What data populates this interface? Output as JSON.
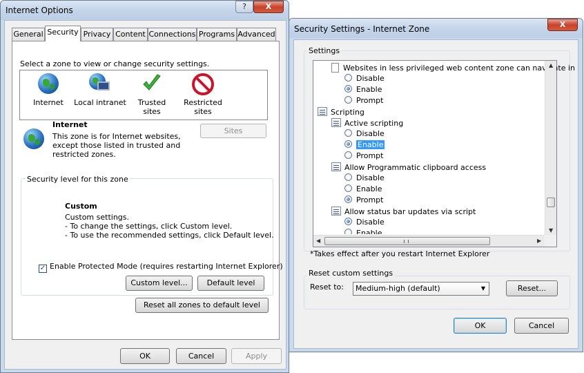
{
  "internet_options": {
    "title": "Internet Options",
    "help_button": "?",
    "close_button": "X",
    "tabs": [
      "General",
      "Security",
      "Privacy",
      "Content",
      "Connections",
      "Programs",
      "Advanced"
    ],
    "active_tab": "Security",
    "zone_prompt": "Select a zone to view or change security settings.",
    "zones": [
      "Internet",
      "Local intranet",
      "Trusted sites",
      "Restricted\nsites"
    ],
    "zone_title": "Internet",
    "zone_description": "This zone is for Internet websites,\nexcept those listed in trusted and\nrestricted zones.",
    "sites_button": "Sites",
    "security_level_label": "Security level for this zone",
    "level_name": "Custom",
    "level_desc": "Custom settings.\n- To change the settings, click Custom level.\n- To use the recommended settings, click Default level.",
    "protected_mode_label": "Enable Protected Mode (requires restarting Internet Explorer)",
    "protected_mode_checked": true,
    "custom_level_button": "Custom level...",
    "default_level_button": "Default level",
    "reset_all_button": "Reset all zones to default level",
    "ok_button": "OK",
    "cancel_button": "Cancel",
    "apply_button": "Apply"
  },
  "security_settings": {
    "title": "Security Settings - Internet Zone",
    "close_button": "X",
    "settings_label": "Settings",
    "tree": {
      "websites_less_privileged": "Websites in less privileged web content zone can navigate in",
      "opt_disable": "Disable",
      "opt_enable": "Enable",
      "opt_prompt": "Prompt",
      "scripting": "Scripting",
      "active_scripting": "Active scripting",
      "clipboard_access": "Allow Programmatic clipboard access",
      "status_bar": "Allow status bar updates via script"
    },
    "restart_note": "*Takes effect after you restart Internet Explorer",
    "reset_group_label": "Reset custom settings",
    "reset_to_label": "Reset to:",
    "reset_to_value": "Medium-high (default)",
    "reset_button": "Reset...",
    "ok_button": "OK",
    "cancel_button": "Cancel"
  },
  "colors": {
    "selection": "#3399ff",
    "title_bar": "#c6d6eb",
    "close_red": "#c8432c"
  }
}
